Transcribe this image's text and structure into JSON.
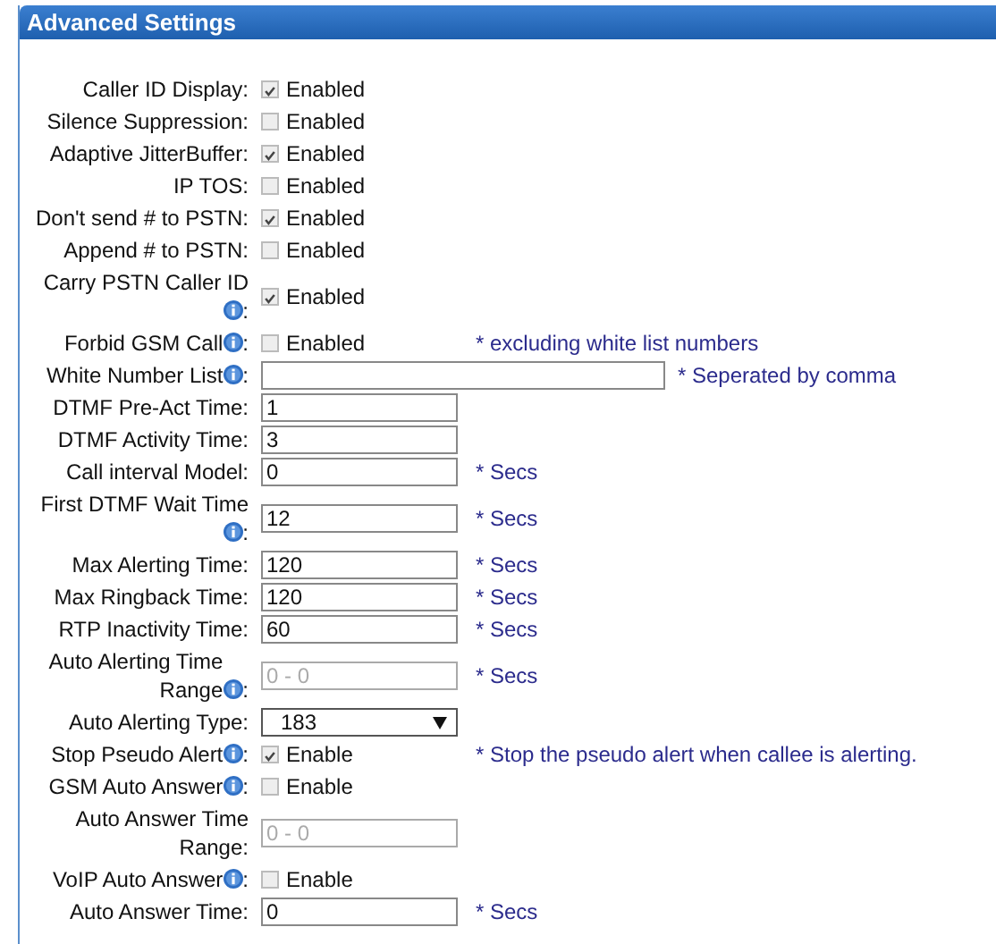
{
  "panel": {
    "title": "Advanced Settings"
  },
  "rows": [
    {
      "kind": "checkbox",
      "label": "Caller ID Display:",
      "info": false,
      "checked": true,
      "option": "Enabled"
    },
    {
      "kind": "checkbox",
      "label": "Silence Suppression:",
      "info": false,
      "checked": false,
      "option": "Enabled"
    },
    {
      "kind": "checkbox",
      "label": "Adaptive JitterBuffer:",
      "info": false,
      "checked": true,
      "option": "Enabled"
    },
    {
      "kind": "checkbox",
      "label": "IP TOS:",
      "info": false,
      "checked": false,
      "option": "Enabled"
    },
    {
      "kind": "checkbox",
      "label": "Don't send # to PSTN:",
      "info": false,
      "checked": true,
      "option": "Enabled"
    },
    {
      "kind": "checkbox",
      "label": "Append # to PSTN:",
      "info": false,
      "checked": false,
      "option": "Enabled"
    },
    {
      "kind": "checkbox",
      "label": "Carry PSTN Caller ID",
      "info": true,
      "after_icon": ":",
      "checked": true,
      "option": "Enabled"
    },
    {
      "kind": "checkbox",
      "label": "Forbid GSM Call",
      "info": true,
      "after_icon": ":",
      "checked": false,
      "option": "Enabled",
      "note": "* excluding white list numbers"
    },
    {
      "kind": "wide-input",
      "label": "White Number List",
      "info": true,
      "after_icon": ":",
      "value": "",
      "disabled": false,
      "note": "* Seperated by comma"
    },
    {
      "kind": "input",
      "label": "DTMF Pre-Act Time:",
      "info": false,
      "value": "1",
      "disabled": false
    },
    {
      "kind": "input",
      "label": "DTMF Activity Time:",
      "info": false,
      "value": "3",
      "disabled": false
    },
    {
      "kind": "input",
      "label": "Call interval Model:",
      "info": false,
      "value": "0",
      "disabled": false,
      "note": "* Secs"
    },
    {
      "kind": "input",
      "label": "First DTMF Wait Time",
      "info": true,
      "after_icon": ":",
      "value": "12",
      "disabled": false,
      "note": "* Secs"
    },
    {
      "kind": "input",
      "label": "Max Alerting Time:",
      "info": false,
      "value": "120",
      "disabled": false,
      "note": "* Secs"
    },
    {
      "kind": "input",
      "label": "Max Ringback Time:",
      "info": false,
      "value": "120",
      "disabled": false,
      "note": "* Secs"
    },
    {
      "kind": "input",
      "label": "RTP Inactivity Time:",
      "info": false,
      "value": "60",
      "disabled": false,
      "note": "* Secs"
    },
    {
      "kind": "input",
      "label": "Auto Alerting Time Range",
      "info": true,
      "after_icon": ":",
      "value": "0 - 0",
      "disabled": true,
      "note": "* Secs"
    },
    {
      "kind": "select",
      "label": "Auto Alerting Type:",
      "info": false,
      "value": "183"
    },
    {
      "kind": "checkbox",
      "label": "Stop Pseudo Alert",
      "info": true,
      "after_icon": ":",
      "checked": true,
      "option": "Enable",
      "note": "* Stop the pseudo alert when callee is alerting."
    },
    {
      "kind": "checkbox",
      "label": "GSM Auto Answer",
      "info": true,
      "after_icon": ":",
      "checked": false,
      "option": "Enable"
    },
    {
      "kind": "input",
      "label": "Auto Answer Time Range:",
      "info": false,
      "value": "0 - 0",
      "disabled": true
    },
    {
      "kind": "checkbox",
      "label": "VoIP Auto Answer",
      "info": true,
      "after_icon": ":",
      "checked": false,
      "option": "Enable"
    },
    {
      "kind": "input",
      "label": "Auto Answer Time:",
      "info": false,
      "value": "0",
      "disabled": false,
      "note": "* Secs"
    }
  ]
}
